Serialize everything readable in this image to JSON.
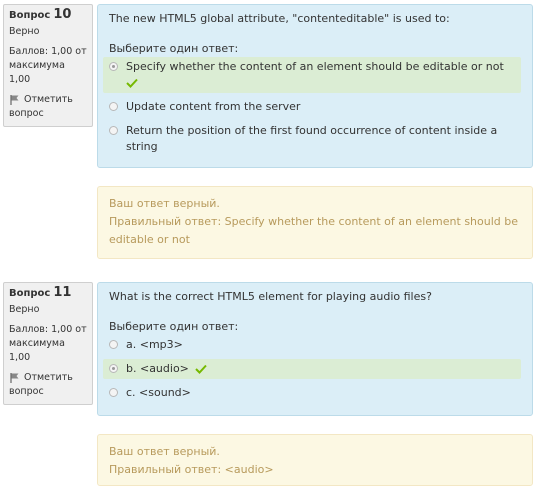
{
  "questions": [
    {
      "label": "Вопрос",
      "number": "10",
      "state": "Верно",
      "grade_line1": "Баллов: 1,00 от",
      "grade_line2": "максимума 1,00",
      "flag_label_line1": "Отметить",
      "flag_label_line2": "вопрос",
      "text": "The new HTML5 global attribute, \"contenteditable\" is used to:",
      "prompt": "Выберите один ответ:",
      "options": [
        {
          "text": "Specify whether the content of an element should be editable or not",
          "selected": true,
          "correct": true
        },
        {
          "text": "Update content from the server",
          "selected": false,
          "correct": false
        },
        {
          "text": "Return the position of the first found occurrence of content inside a string",
          "selected": false,
          "correct": false
        }
      ],
      "feedback_status": "Ваш ответ верный.",
      "feedback_correct": "Правильный ответ: Specify whether the content of an element should be editable or not"
    },
    {
      "label": "Вопрос",
      "number": "11",
      "state": "Верно",
      "grade_line1": "Баллов: 1,00 от",
      "grade_line2": "максимума 1,00",
      "flag_label_line1": "Отметить",
      "flag_label_line2": "вопрос",
      "text": "What is the correct HTML5 element for playing audio files?",
      "prompt": "Выберите один ответ:",
      "options": [
        {
          "text": "a. <mp3>",
          "selected": false,
          "correct": false
        },
        {
          "text": "b. <audio>",
          "selected": true,
          "correct": true
        },
        {
          "text": "c. <sound>",
          "selected": false,
          "correct": false
        }
      ],
      "feedback_status": "Ваш ответ верный.",
      "feedback_correct": "Правильный ответ: <audio>"
    }
  ],
  "colors": {
    "info_bg": "#f0f0f0",
    "question_bg": "#dbeef7",
    "correct_option_bg": "#dbedd4",
    "feedback_bg": "#fcf8e3",
    "feedback_text": "#b79a5c",
    "check_green": "#76b900"
  },
  "icons": {
    "flag": "flag-icon",
    "correct": "checkmark-icon"
  }
}
